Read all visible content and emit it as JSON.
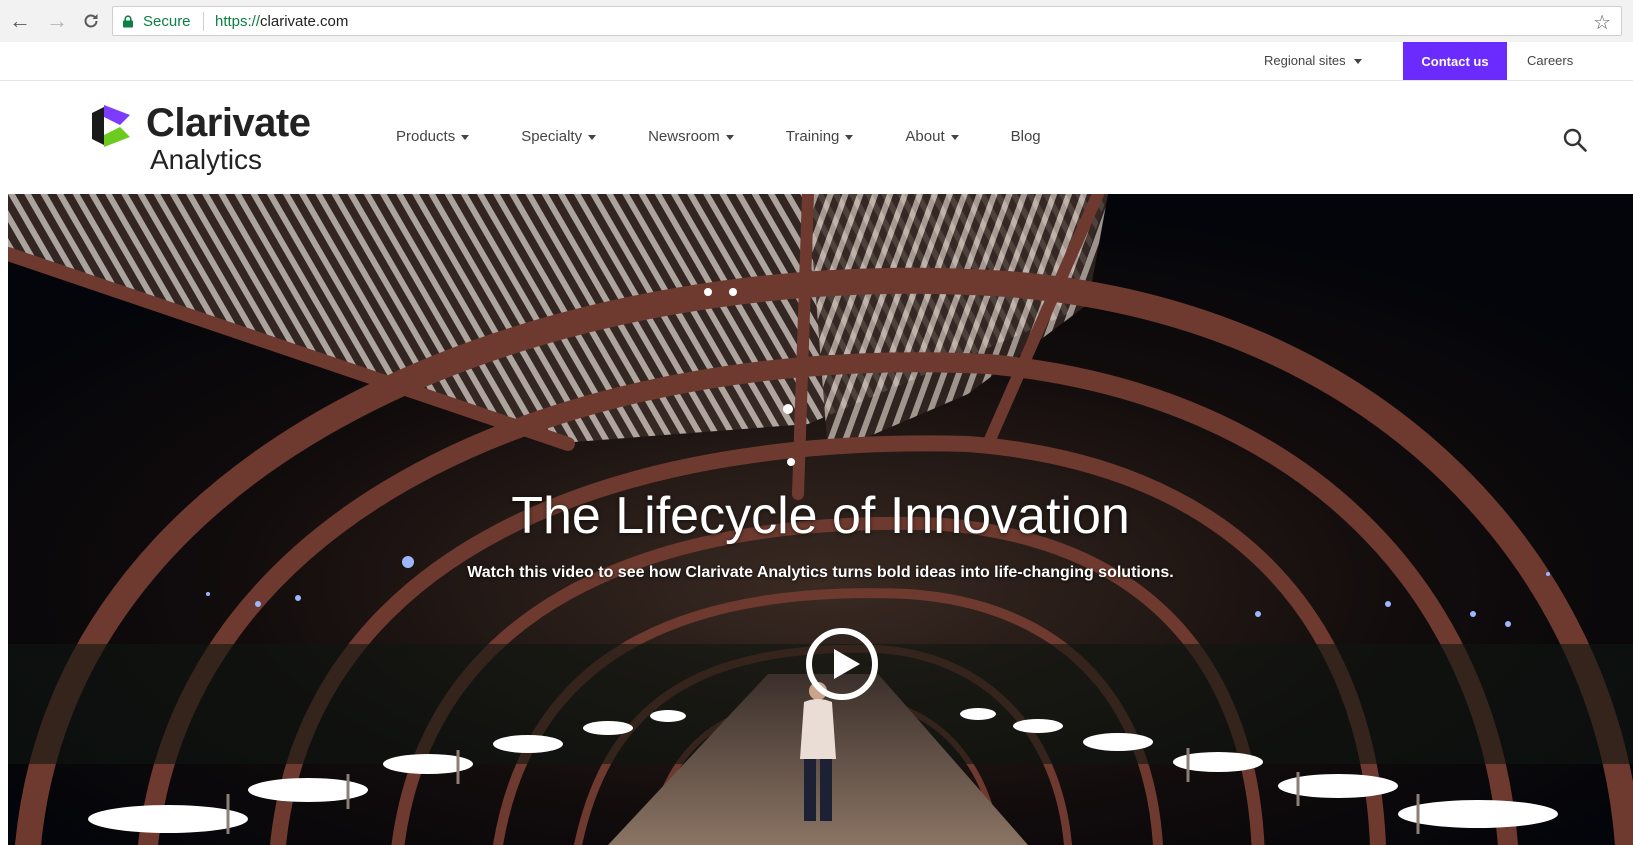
{
  "browser": {
    "secure_label": "Secure",
    "url_scheme": "https://",
    "url_host": "clarivate.com",
    "bookmark_icon": "star-icon"
  },
  "utility": {
    "regional_sites": "Regional sites",
    "contact_us": "Contact us",
    "careers": "Careers"
  },
  "brand": {
    "name": "Clarivate",
    "sub": "Analytics"
  },
  "nav": {
    "items": [
      {
        "label": "Products",
        "dropdown": true
      },
      {
        "label": "Specialty",
        "dropdown": true
      },
      {
        "label": "Newsroom",
        "dropdown": true
      },
      {
        "label": "Training",
        "dropdown": true
      },
      {
        "label": "About",
        "dropdown": true
      },
      {
        "label": "Blog",
        "dropdown": false
      }
    ]
  },
  "hero": {
    "title": "The Lifecycle of Innovation",
    "subtitle": "Watch this video to see how Clarivate Analytics turns bold ideas into life-changing solutions."
  },
  "colors": {
    "accent": "#6b2bff",
    "secure_green": "#0b8043",
    "logo_purple": "#7b3cff",
    "logo_green": "#6ccb1f",
    "logo_dark": "#1a1a1a"
  }
}
